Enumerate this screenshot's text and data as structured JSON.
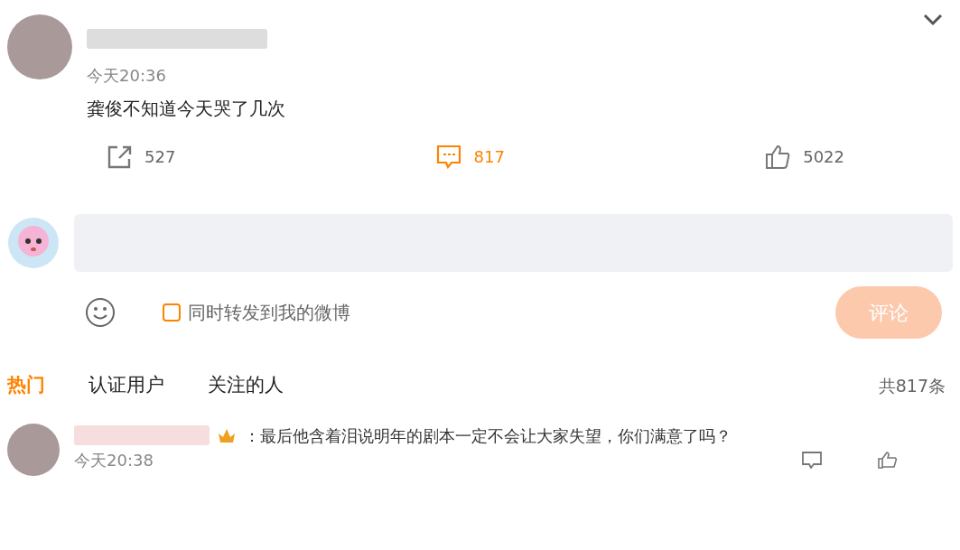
{
  "post": {
    "time": "今天20:36",
    "text": "龚俊不知道今天哭了几次",
    "actions": [
      {
        "kind": "repost",
        "count": "527",
        "selected": false
      },
      {
        "kind": "comment",
        "count": "817",
        "selected": true
      },
      {
        "kind": "like",
        "count": "5022",
        "selected": false
      }
    ]
  },
  "composer": {
    "share_label": "同时转发到我的微博",
    "share_checked": false,
    "submit": "评论",
    "submit_disabled": true
  },
  "tabs": [
    {
      "label": "热门",
      "selected": true
    },
    {
      "label": "认证用户",
      "selected": false
    },
    {
      "label": "关注的人",
      "selected": false
    }
  ],
  "total": "共817条",
  "comments": [
    {
      "text": "：最后他含着泪说明年的剧本一定不会让大家失望，你们满意了吗？",
      "time": "今天20:38"
    }
  ]
}
